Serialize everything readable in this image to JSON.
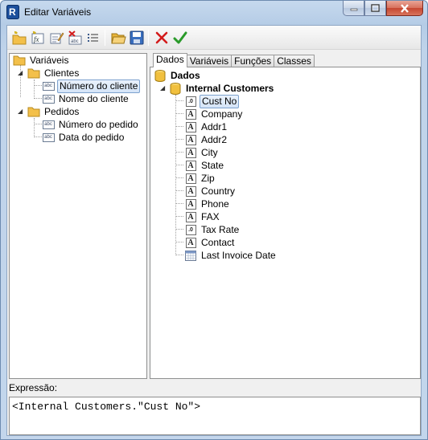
{
  "window": {
    "title": "Editar Variáveis"
  },
  "toolbar": {
    "buttons": [
      "new-category",
      "new-variable",
      "edit",
      "delete",
      "list",
      "open",
      "save",
      "cancel",
      "ok"
    ],
    "cancel_color": "#d31b1b",
    "ok_color": "#2a9a2a"
  },
  "left_tree": {
    "root": "Variáveis",
    "groups": [
      {
        "label": "Clientes",
        "items": [
          "Número do cliente",
          "Nome do cliente"
        ]
      },
      {
        "label": "Pedidos",
        "items": [
          "Número do pedido",
          "Data do pedido"
        ]
      }
    ]
  },
  "tabs": [
    "Dados",
    "Variáveis",
    "Funções",
    "Classes"
  ],
  "data_tree": {
    "root": "Dados",
    "table": "Internal Customers",
    "fields": [
      {
        "label": "Cust No",
        "type": "number",
        "glyph": ".0"
      },
      {
        "label": "Company",
        "type": "text",
        "glyph": "A"
      },
      {
        "label": "Addr1",
        "type": "text",
        "glyph": "A"
      },
      {
        "label": "Addr2",
        "type": "text",
        "glyph": "A"
      },
      {
        "label": "City",
        "type": "text",
        "glyph": "A"
      },
      {
        "label": "State",
        "type": "text",
        "glyph": "A"
      },
      {
        "label": "Zip",
        "type": "text",
        "glyph": "A"
      },
      {
        "label": "Country",
        "type": "text",
        "glyph": "A"
      },
      {
        "label": "Phone",
        "type": "text",
        "glyph": "A"
      },
      {
        "label": "FAX",
        "type": "text",
        "glyph": "A"
      },
      {
        "label": "Tax Rate",
        "type": "number",
        "glyph": ".0"
      },
      {
        "label": "Contact",
        "type": "text",
        "glyph": "A"
      },
      {
        "label": "Last Invoice Date",
        "type": "date",
        "glyph": ""
      }
    ]
  },
  "abc_glyph": "abc",
  "expression": {
    "label": "Expressão:",
    "value": "<Internal Customers.\"Cust No\">"
  }
}
